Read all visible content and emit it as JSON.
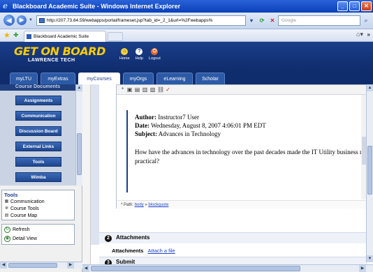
{
  "window": {
    "title": "Blackboard Academic Suite - Windows Internet Explorer",
    "buttons": {
      "minimize": "_",
      "maximize": "□",
      "close": "✕"
    }
  },
  "browser": {
    "url": "http://207.73.64.59/webapps/portal/frameset.jsp?tab_id=_2_1&url=%2Fwebapps%",
    "search_placeholder": "Google",
    "tab_title": "Blackboard Academic Suite"
  },
  "header": {
    "logo_main": "GET ON BOARD",
    "logo_sub": "LAWRENCE TECH",
    "quick_links": [
      {
        "label": "Home"
      },
      {
        "label": "Help"
      },
      {
        "label": "Logout"
      }
    ]
  },
  "tabs": [
    {
      "label": "myLTU"
    },
    {
      "label": "myExtras"
    },
    {
      "label": "myCourses"
    },
    {
      "label": "myOrgs"
    },
    {
      "label": "eLearning"
    },
    {
      "label": "Scholar"
    }
  ],
  "course_menu": {
    "header": "Course Documents",
    "buttons": [
      {
        "label": "Assignments"
      },
      {
        "label": "Communication"
      },
      {
        "label": "Discussion Board"
      },
      {
        "label": "External Links"
      },
      {
        "label": "Tools"
      },
      {
        "label": "Wimba"
      }
    ]
  },
  "tools_panel": {
    "title": "Tools",
    "items": [
      {
        "label": "Communication"
      },
      {
        "label": "Course Tools"
      },
      {
        "label": "Course Map"
      }
    ]
  },
  "view_panel": {
    "items": [
      {
        "label": "Refresh"
      },
      {
        "label": "Detail View"
      }
    ]
  },
  "post": {
    "author_label": "Author:",
    "author": "Instructor7 User",
    "date_label": "Date:",
    "date": "Wednesday, August 8, 2007 4:06:01 PM EDT",
    "subject_label": "Subject:",
    "subject": "Advances in Technology",
    "question": "How have the advances in technology over the past decades made the IT Utility business m practical?"
  },
  "editor_path": {
    "label": "Path:",
    "body": "body",
    "sep": "»",
    "blockquote": "blockquote"
  },
  "sections": {
    "attachments_num": "2",
    "attachments_title": "Attachments",
    "attachments_label": "Attachments",
    "attach_link": "Attach a file",
    "submit_num": "3",
    "submit_title": "Submit"
  }
}
